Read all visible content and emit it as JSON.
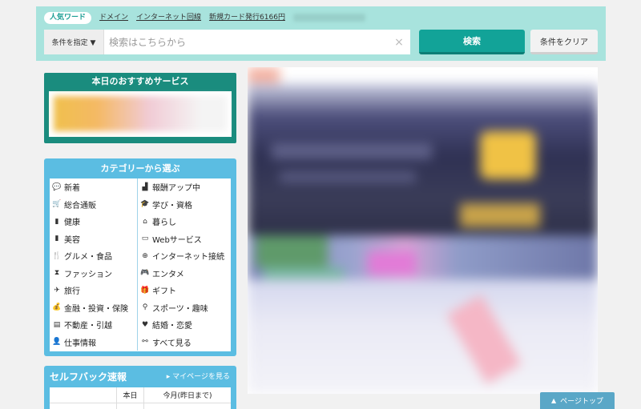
{
  "search": {
    "popular_label": "人気ワード",
    "popular_words": [
      "ドメイン",
      "インターネット回線",
      "新規カード発行6166円"
    ],
    "condition_button": "条件を指定 ▼",
    "placeholder": "検索はこちらから",
    "clear_icon": "×",
    "search_button": "検索",
    "clear_conditions_button": "条件をクリア"
  },
  "recommended": {
    "title": "本日のおすすめサービス"
  },
  "categories": {
    "title": "カテゴリーから選ぶ",
    "items": [
      {
        "icon": "speech-bubble-icon",
        "glyph": "💬",
        "label": "新着"
      },
      {
        "icon": "bar-chart-icon",
        "glyph": "▟",
        "label": "報酬アップ中"
      },
      {
        "icon": "cart-icon",
        "glyph": "🛒",
        "label": "総合通販"
      },
      {
        "icon": "graduation-cap-icon",
        "glyph": "🎓",
        "label": "学び・資格"
      },
      {
        "icon": "bottle-icon",
        "glyph": "▮",
        "label": "健康"
      },
      {
        "icon": "house-icon",
        "glyph": "⌂",
        "label": "暮らし"
      },
      {
        "icon": "cosmetics-icon",
        "glyph": "▮",
        "label": "美容"
      },
      {
        "icon": "monitor-icon",
        "glyph": "▭",
        "label": "Webサービス"
      },
      {
        "icon": "fork-knife-icon",
        "glyph": "🍴",
        "label": "グルメ・食品"
      },
      {
        "icon": "globe-icon",
        "glyph": "⊕",
        "label": "インターネット接続"
      },
      {
        "icon": "mannequin-icon",
        "glyph": "⧗",
        "label": "ファッション"
      },
      {
        "icon": "gamepad-icon",
        "glyph": "🎮",
        "label": "エンタメ"
      },
      {
        "icon": "airplane-icon",
        "glyph": "✈",
        "label": "旅行"
      },
      {
        "icon": "gift-icon",
        "glyph": "🎁",
        "label": "ギフト"
      },
      {
        "icon": "money-bag-icon",
        "glyph": "💰",
        "label": "金融・投資・保険"
      },
      {
        "icon": "whistle-icon",
        "glyph": "⚲",
        "label": "スポーツ・趣味"
      },
      {
        "icon": "storefront-icon",
        "glyph": "▤",
        "label": "不動産・引越"
      },
      {
        "icon": "heart-icon",
        "glyph": "♥",
        "label": "結婚・恋愛"
      },
      {
        "icon": "person-icon",
        "glyph": "👤",
        "label": "仕事情報"
      },
      {
        "icon": "binoculars-icon",
        "glyph": "⚯",
        "label": "すべて見る"
      }
    ]
  },
  "selfback": {
    "title": "セルフバック速報",
    "mypage_link": "▸ マイページを見る",
    "col_today": "本日",
    "col_month": "今月(昨日まで)"
  },
  "page_top": {
    "arrow": "▲",
    "label": "ページトップ"
  },
  "colors": {
    "teal_band": "#a8e3dd",
    "search_button": "#12a398",
    "recommend_box": "#1a8c7e",
    "category_box": "#5bbde2",
    "page_top": "#5aa7c7"
  }
}
